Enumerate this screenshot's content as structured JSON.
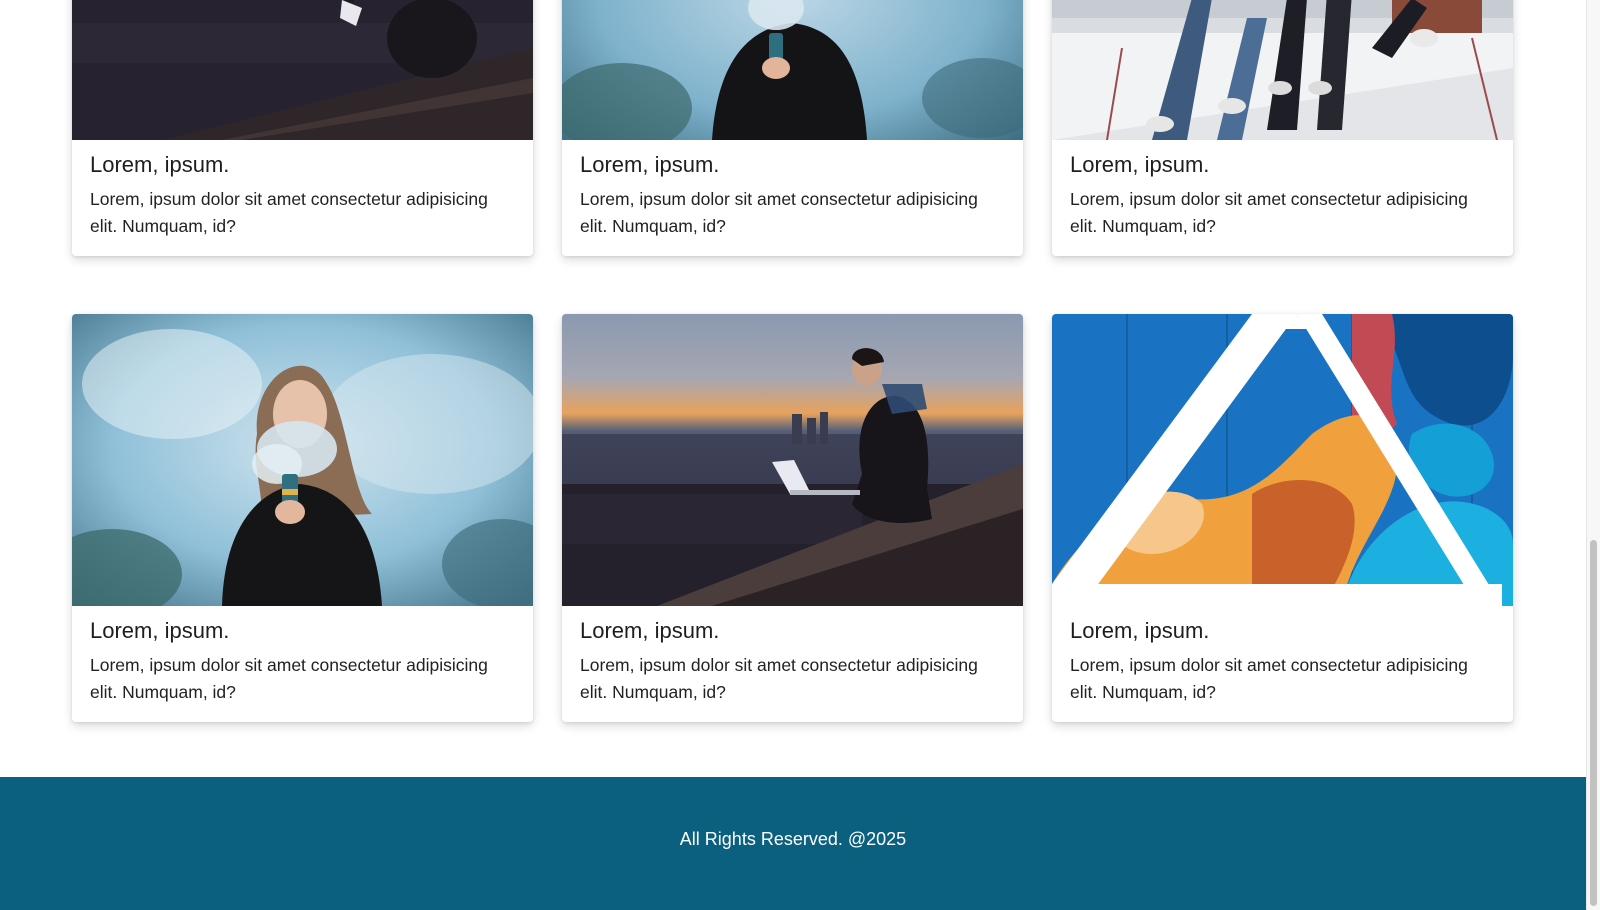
{
  "cards": [
    {
      "title": "Lorem, ipsum.",
      "text": "Lorem, ipsum dolor sit amet consectetur adipisicing elit. Numquam, id?",
      "image": "man-laptop-city-dusk"
    },
    {
      "title": "Lorem, ipsum.",
      "text": "Lorem, ipsum dolor sit amet consectetur adipisicing elit. Numquam, id?",
      "image": "woman-blue-smoke"
    },
    {
      "title": "Lorem, ipsum.",
      "text": "Lorem, ipsum dolor sit amet consectetur adipisicing elit. Numquam, id?",
      "image": "people-jumping-snow"
    },
    {
      "title": "Lorem, ipsum.",
      "text": "Lorem, ipsum dolor sit amet consectetur adipisicing elit. Numquam, id?",
      "image": "woman-blue-smoke"
    },
    {
      "title": "Lorem, ipsum.",
      "text": "Lorem, ipsum dolor sit amet consectetur adipisicing elit. Numquam, id?",
      "image": "man-laptop-city-dusk"
    },
    {
      "title": "Lorem, ipsum.",
      "text": "Lorem, ipsum dolor sit amet consectetur adipisicing elit. Numquam, id?",
      "image": "colorful-triangle-mural"
    }
  ],
  "footer": {
    "text": "All Rights Reserved. @2025"
  },
  "colors": {
    "footer_bg": "#0b5f7f",
    "footer_text": "#ffffff",
    "card_bg": "#ffffff"
  }
}
